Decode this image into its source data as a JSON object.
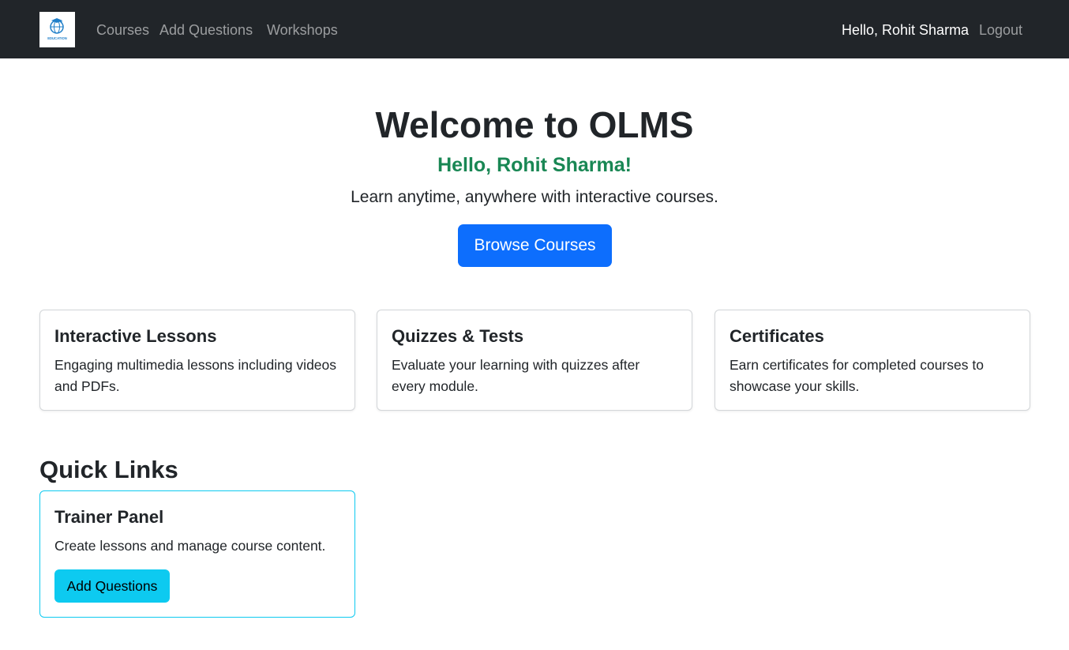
{
  "navbar": {
    "logo_icon": "education-globe-logo",
    "logo_text": "EDUCATION",
    "links": [
      {
        "label": "Courses"
      },
      {
        "label": "Add Questions"
      },
      {
        "label": "Workshops"
      }
    ],
    "greeting": "Hello, Rohit Sharma",
    "logout_label": "Logout"
  },
  "hero": {
    "title": "Welcome to OLMS",
    "hello": "Hello, Rohit Sharma!",
    "lead": "Learn anytime, anywhere with interactive courses.",
    "button_label": "Browse Courses"
  },
  "features": [
    {
      "title": "Interactive Lessons",
      "text": "Engaging multimedia lessons including videos and PDFs."
    },
    {
      "title": "Quizzes & Tests",
      "text": "Evaluate your learning with quizzes after every module."
    },
    {
      "title": "Certificates",
      "text": "Earn certificates for completed courses to showcase your skills."
    }
  ],
  "quick_links": {
    "heading": "Quick Links",
    "trainer": {
      "title": "Trainer Panel",
      "text": "Create lessons and manage course content.",
      "button_label": "Add Questions"
    }
  },
  "colors": {
    "navbar_bg": "#212529",
    "primary": "#0d6efd",
    "success": "#198754",
    "info": "#0dcaf0"
  }
}
